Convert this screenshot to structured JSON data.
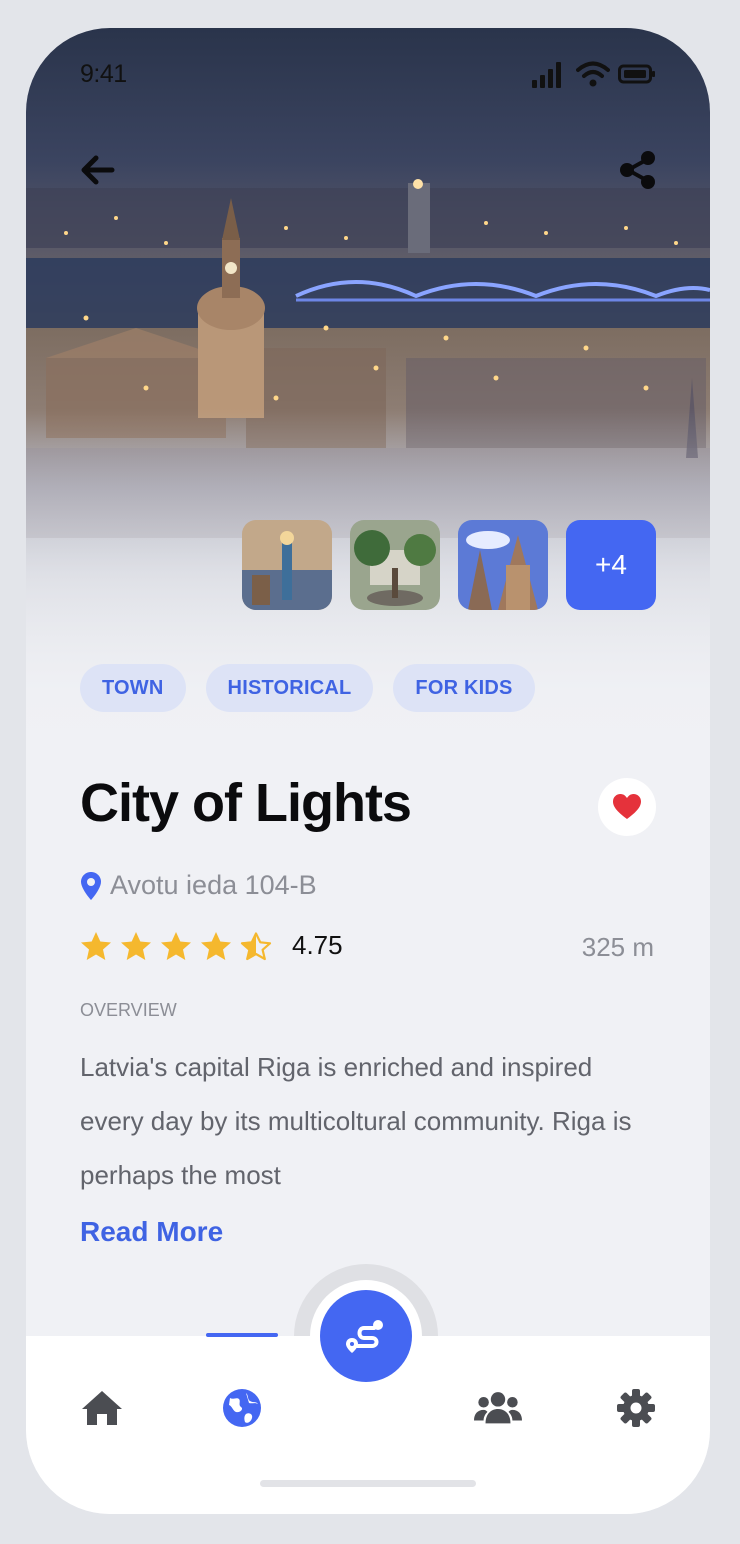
{
  "status_bar": {
    "time": "9:41"
  },
  "hero": {
    "gallery_more_label": "+4"
  },
  "tags": [
    "TOWN",
    "HISTORICAL",
    "FOR KIDS"
  ],
  "place": {
    "title": "City of Lights",
    "address": "Avotu ieda 104-B",
    "rating": "4.75",
    "rating_stars_value": 4.5,
    "distance": "325 m",
    "overview_label": "OVERVIEW",
    "overview_text": "Latvia's capital Riga is enriched and inspired every day by its multicoltural community. Riga is perhaps the most",
    "read_more": "Read More",
    "is_favorite": true
  },
  "nav": {
    "items": [
      "home-icon",
      "globe-icon",
      "route-icon",
      "users-icon",
      "gear-icon"
    ],
    "active": "globe-icon"
  },
  "colors": {
    "accent": "#4467f2",
    "tag_bg": "#dde3f6",
    "favorite": "#e5323b",
    "star": "#f5b82e"
  }
}
